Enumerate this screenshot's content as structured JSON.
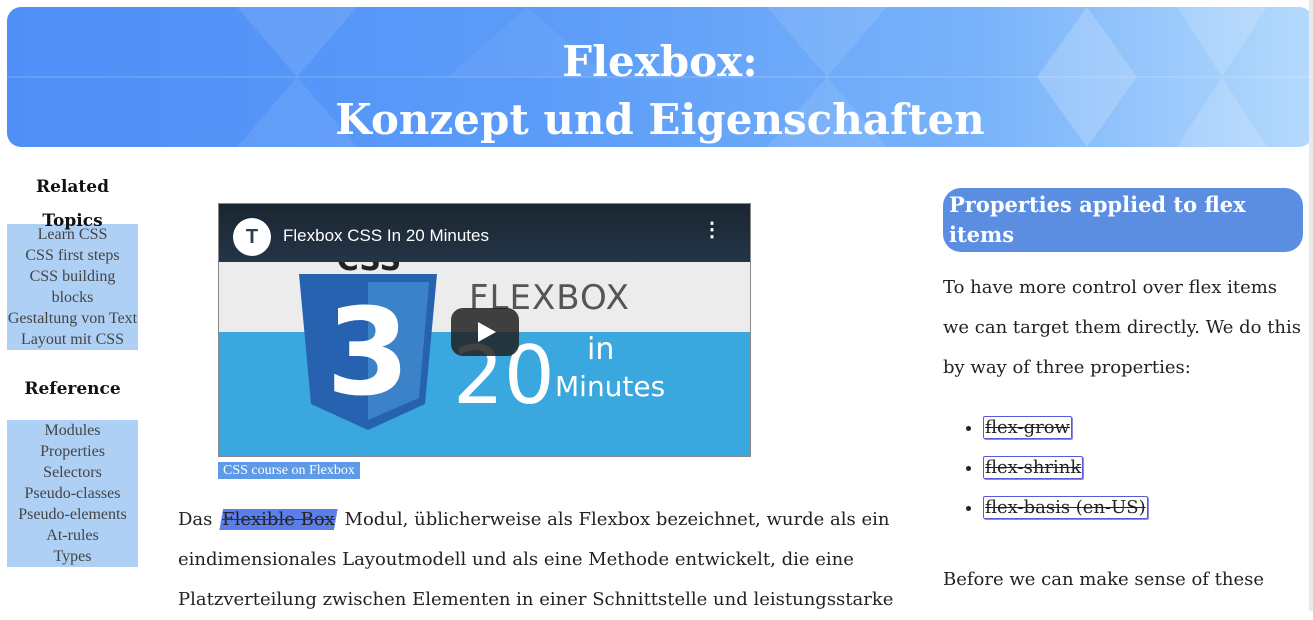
{
  "header": {
    "title_line1": "Flexbox:",
    "title_line2": "Konzept und Eigenschaften",
    "colors": {
      "start": "#4f8ff7",
      "end": "#b5dafd"
    }
  },
  "sidebar": {
    "related_heading": "Related Topics",
    "related_items": [
      "Learn CSS",
      "CSS first steps",
      "CSS building blocks",
      "Gestaltung von Text",
      "Layout mit CSS"
    ],
    "reference_heading": "Reference",
    "reference_items": [
      "Modules",
      "Properties",
      "Selectors",
      "Pseudo-classes",
      "Pseudo-elements",
      "At-rules",
      "Types"
    ]
  },
  "video": {
    "title": "Flexbox CSS In 20 Minutes",
    "channel_icon": "T",
    "more_icon": "⋮",
    "thumb_text_big": "FLEXBOX",
    "thumb_number": "20",
    "thumb_in": "in",
    "thumb_minutes": "Minutes",
    "caption": "CSS course on Flexbox"
  },
  "main": {
    "intro_before": "Das ",
    "intro_highlight": "Flexible Box",
    "intro_after": " Modul, üblicherweise als Flexbox bezeichnet, wurde als ein eindimensionales Layoutmodell und als eine Methode entwickelt, die eine Platzverteilung zwischen Elementen in einer Schnittstelle und leistungsstarke"
  },
  "right": {
    "heading": "Properties applied to flex items",
    "paragraph": "To have more control over flex items we can target them directly. We do this by way of three properties:",
    "properties": [
      "flex-grow",
      "flex-shrink",
      "flex-basis (en-US)"
    ],
    "paragraph2": "Before we can make sense of these"
  }
}
